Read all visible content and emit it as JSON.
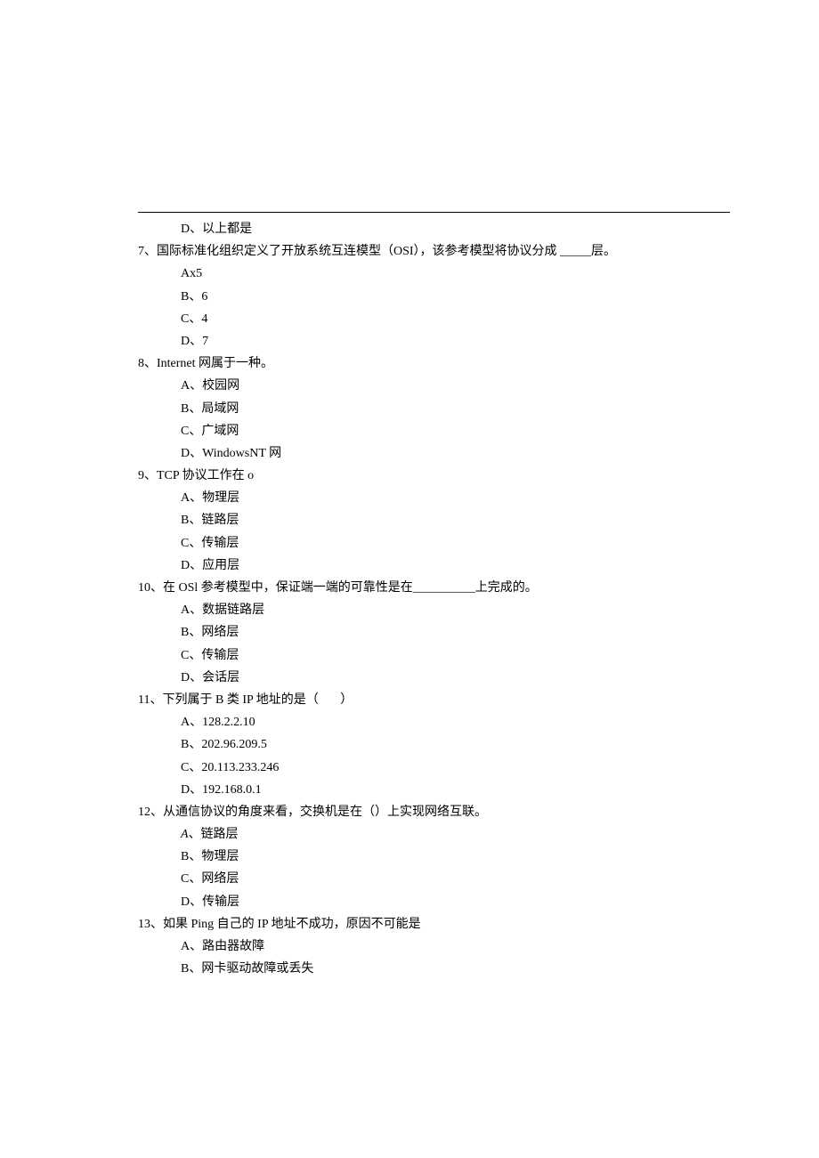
{
  "orphan_option": "D、以上都是",
  "questions": [
    {
      "num": "7、",
      "text": "国际标准化组织定义了开放系统互连模型（OSI），该参考模型将协议分成 _____层。",
      "options": [
        "Ax5",
        "B、6",
        "C、4",
        "D、7"
      ]
    },
    {
      "num": "8、",
      "text": "Internet 网属于一种。",
      "options": [
        "A、校园网",
        "B、局域网",
        "C、广域网",
        "D、WindowsNT 网"
      ]
    },
    {
      "num": "9、",
      "text": "TCP 协议工作在 o",
      "options": [
        "A、物理层",
        "B、链路层",
        "C、传输层",
        "D、应用层"
      ]
    },
    {
      "num": "10、",
      "text": "在 OSl 参考模型中，保证端一端的可靠性是在__________上完成的。",
      "options": [
        "A、数据链路层",
        "B、网络层",
        "C、传输层",
        "D、会话层"
      ]
    },
    {
      "num": "11、",
      "text": "下列属于 B 类 IP 地址的是（       ）",
      "options": [
        "A、128.2.2.10",
        "B、202.96.209.5",
        "C、20.113.233.246",
        "D、192.168.0.1"
      ]
    },
    {
      "num": "12、",
      "text": "从通信协议的角度来看，交换机是在（）上实现网络互联。",
      "options_special": [
        {
          "label": "A",
          "labelStyle": "italic-a",
          "sep": "、",
          "text": "链路层"
        },
        {
          "label": "B",
          "labelStyle": "",
          "sep": "、",
          "text": "物理层"
        },
        {
          "label": "C",
          "labelStyle": "",
          "sep": "、",
          "text": "网络层"
        },
        {
          "label": "D",
          "labelStyle": "",
          "sep": "、",
          "text": "传输层"
        }
      ]
    },
    {
      "num": "13、",
      "text": "如果 Ping 自己的 IP 地址不成功，原因不可能是",
      "options": [
        "A、路由器故障",
        "B、网卡驱动故障或丢失"
      ]
    }
  ]
}
